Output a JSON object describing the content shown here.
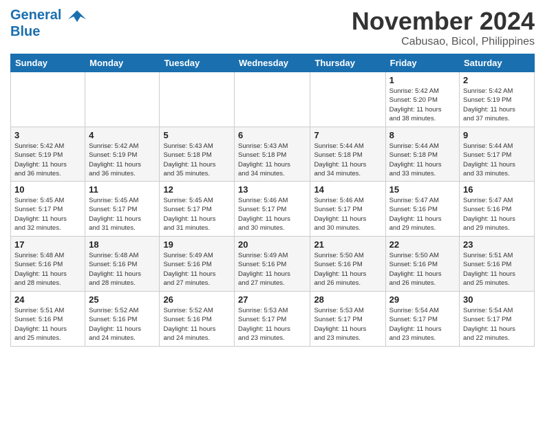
{
  "header": {
    "logo_line1": "General",
    "logo_line2": "Blue",
    "month": "November 2024",
    "location": "Cabusao, Bicol, Philippines"
  },
  "weekdays": [
    "Sunday",
    "Monday",
    "Tuesday",
    "Wednesday",
    "Thursday",
    "Friday",
    "Saturday"
  ],
  "weeks": [
    [
      {
        "day": "",
        "info": ""
      },
      {
        "day": "",
        "info": ""
      },
      {
        "day": "",
        "info": ""
      },
      {
        "day": "",
        "info": ""
      },
      {
        "day": "",
        "info": ""
      },
      {
        "day": "1",
        "info": "Sunrise: 5:42 AM\nSunset: 5:20 PM\nDaylight: 11 hours\nand 38 minutes."
      },
      {
        "day": "2",
        "info": "Sunrise: 5:42 AM\nSunset: 5:19 PM\nDaylight: 11 hours\nand 37 minutes."
      }
    ],
    [
      {
        "day": "3",
        "info": "Sunrise: 5:42 AM\nSunset: 5:19 PM\nDaylight: 11 hours\nand 36 minutes."
      },
      {
        "day": "4",
        "info": "Sunrise: 5:42 AM\nSunset: 5:19 PM\nDaylight: 11 hours\nand 36 minutes."
      },
      {
        "day": "5",
        "info": "Sunrise: 5:43 AM\nSunset: 5:18 PM\nDaylight: 11 hours\nand 35 minutes."
      },
      {
        "day": "6",
        "info": "Sunrise: 5:43 AM\nSunset: 5:18 PM\nDaylight: 11 hours\nand 34 minutes."
      },
      {
        "day": "7",
        "info": "Sunrise: 5:44 AM\nSunset: 5:18 PM\nDaylight: 11 hours\nand 34 minutes."
      },
      {
        "day": "8",
        "info": "Sunrise: 5:44 AM\nSunset: 5:18 PM\nDaylight: 11 hours\nand 33 minutes."
      },
      {
        "day": "9",
        "info": "Sunrise: 5:44 AM\nSunset: 5:17 PM\nDaylight: 11 hours\nand 33 minutes."
      }
    ],
    [
      {
        "day": "10",
        "info": "Sunrise: 5:45 AM\nSunset: 5:17 PM\nDaylight: 11 hours\nand 32 minutes."
      },
      {
        "day": "11",
        "info": "Sunrise: 5:45 AM\nSunset: 5:17 PM\nDaylight: 11 hours\nand 31 minutes."
      },
      {
        "day": "12",
        "info": "Sunrise: 5:45 AM\nSunset: 5:17 PM\nDaylight: 11 hours\nand 31 minutes."
      },
      {
        "day": "13",
        "info": "Sunrise: 5:46 AM\nSunset: 5:17 PM\nDaylight: 11 hours\nand 30 minutes."
      },
      {
        "day": "14",
        "info": "Sunrise: 5:46 AM\nSunset: 5:17 PM\nDaylight: 11 hours\nand 30 minutes."
      },
      {
        "day": "15",
        "info": "Sunrise: 5:47 AM\nSunset: 5:16 PM\nDaylight: 11 hours\nand 29 minutes."
      },
      {
        "day": "16",
        "info": "Sunrise: 5:47 AM\nSunset: 5:16 PM\nDaylight: 11 hours\nand 29 minutes."
      }
    ],
    [
      {
        "day": "17",
        "info": "Sunrise: 5:48 AM\nSunset: 5:16 PM\nDaylight: 11 hours\nand 28 minutes."
      },
      {
        "day": "18",
        "info": "Sunrise: 5:48 AM\nSunset: 5:16 PM\nDaylight: 11 hours\nand 28 minutes."
      },
      {
        "day": "19",
        "info": "Sunrise: 5:49 AM\nSunset: 5:16 PM\nDaylight: 11 hours\nand 27 minutes."
      },
      {
        "day": "20",
        "info": "Sunrise: 5:49 AM\nSunset: 5:16 PM\nDaylight: 11 hours\nand 27 minutes."
      },
      {
        "day": "21",
        "info": "Sunrise: 5:50 AM\nSunset: 5:16 PM\nDaylight: 11 hours\nand 26 minutes."
      },
      {
        "day": "22",
        "info": "Sunrise: 5:50 AM\nSunset: 5:16 PM\nDaylight: 11 hours\nand 26 minutes."
      },
      {
        "day": "23",
        "info": "Sunrise: 5:51 AM\nSunset: 5:16 PM\nDaylight: 11 hours\nand 25 minutes."
      }
    ],
    [
      {
        "day": "24",
        "info": "Sunrise: 5:51 AM\nSunset: 5:16 PM\nDaylight: 11 hours\nand 25 minutes."
      },
      {
        "day": "25",
        "info": "Sunrise: 5:52 AM\nSunset: 5:16 PM\nDaylight: 11 hours\nand 24 minutes."
      },
      {
        "day": "26",
        "info": "Sunrise: 5:52 AM\nSunset: 5:16 PM\nDaylight: 11 hours\nand 24 minutes."
      },
      {
        "day": "27",
        "info": "Sunrise: 5:53 AM\nSunset: 5:17 PM\nDaylight: 11 hours\nand 23 minutes."
      },
      {
        "day": "28",
        "info": "Sunrise: 5:53 AM\nSunset: 5:17 PM\nDaylight: 11 hours\nand 23 minutes."
      },
      {
        "day": "29",
        "info": "Sunrise: 5:54 AM\nSunset: 5:17 PM\nDaylight: 11 hours\nand 23 minutes."
      },
      {
        "day": "30",
        "info": "Sunrise: 5:54 AM\nSunset: 5:17 PM\nDaylight: 11 hours\nand 22 minutes."
      }
    ]
  ]
}
